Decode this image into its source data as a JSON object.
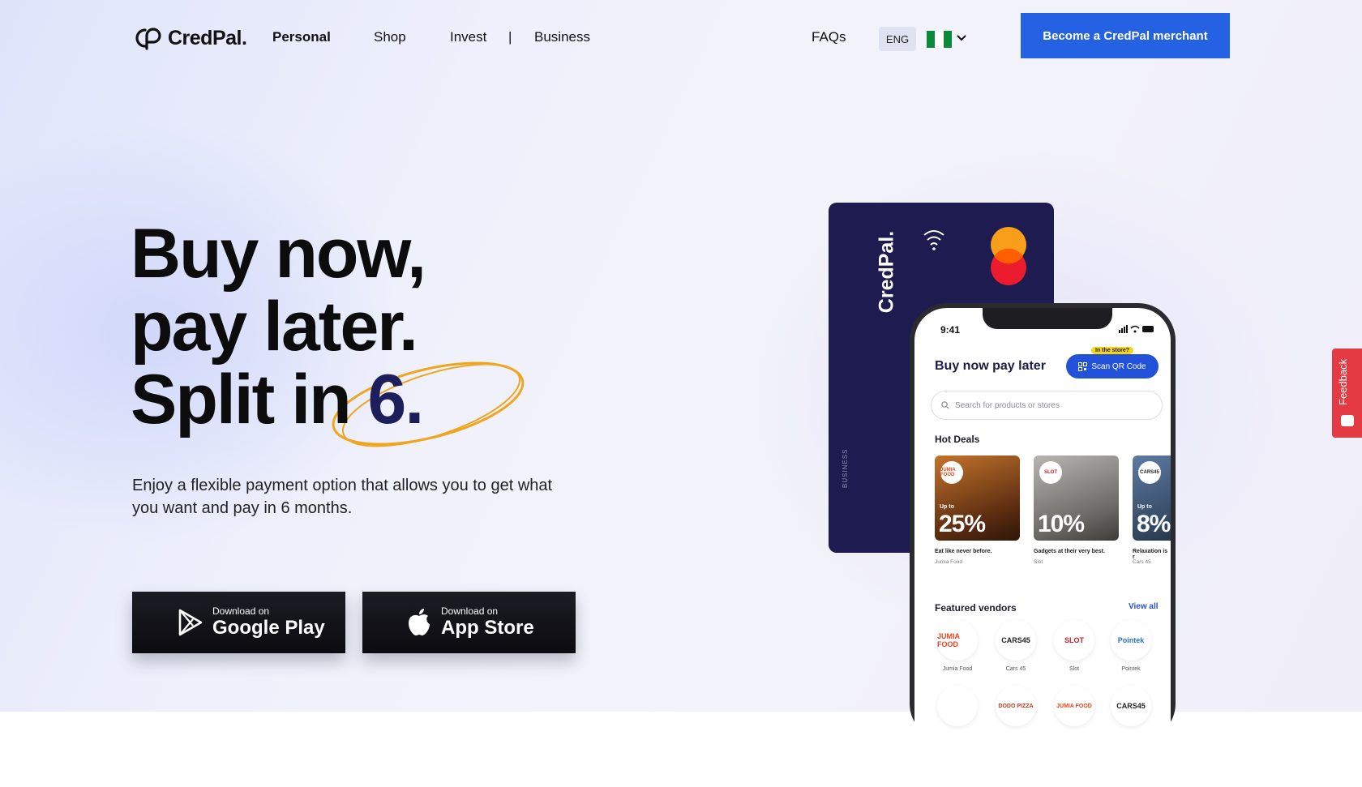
{
  "nav": {
    "logo_text": "CredPal.",
    "links": [
      {
        "label": "Personal"
      },
      {
        "label": "Shop"
      },
      {
        "label": "Invest"
      },
      {
        "label": "Business"
      }
    ],
    "separator": "|",
    "faqs": "FAQs",
    "language": "ENG",
    "cta": "Become a CredPal merchant"
  },
  "hero": {
    "line1": "Buy now,",
    "line2": "pay later.",
    "line3_prefix": "Split in ",
    "line3_highlight": "6.",
    "subtitle": "Enjoy a flexible payment option that allows you to get what you want and pay in 6 months.",
    "google": {
      "small": "Download on",
      "big": "Google Play"
    },
    "apple": {
      "small": "Download on",
      "big": "App Store"
    }
  },
  "card": {
    "brand": "CredPal.",
    "business": "BUSINESS"
  },
  "phone": {
    "time": "9:41",
    "title": "Buy now pay later",
    "qr_tag": "In the store?",
    "qr_button": "Scan QR Code",
    "search_placeholder": "Search for products or stores",
    "hot_deals": "Hot Deals",
    "deals": [
      {
        "badge": "JUMIA FOOD",
        "upto": "Up to",
        "pct": "25%",
        "caption": "Eat like never before.",
        "vendor": "Jumia Food"
      },
      {
        "badge": "SLOT",
        "upto": "",
        "pct": "10%",
        "caption": "Gadgets at their very best.",
        "vendor": "Slot"
      },
      {
        "badge": "CARS45",
        "upto": "Up to",
        "pct": "8%",
        "caption": "Relaxation is r",
        "vendor": "Cars 45"
      }
    ],
    "featured_vendors": "Featured vendors",
    "view_all": "View all",
    "vendors": [
      {
        "logo": "JUMIA FOOD",
        "label": "Jumia Food"
      },
      {
        "logo": "CARS45",
        "label": "Cars 45"
      },
      {
        "logo": "SLOT",
        "label": "Slot"
      },
      {
        "logo": "Pointek",
        "label": "Pointek"
      }
    ],
    "vendors_row2": [
      {
        "logo": ""
      },
      {
        "logo": "DODO PIZZA"
      },
      {
        "logo": "JUMIA FOOD"
      },
      {
        "logo": "CARS45"
      }
    ]
  },
  "feedback": "Feedback",
  "colors": {
    "accent": "#2461e3",
    "card": "#1d1b4f",
    "highlight": "#1d1f5c",
    "scribble": "#f0a51f",
    "feedback": "#e33a44"
  }
}
